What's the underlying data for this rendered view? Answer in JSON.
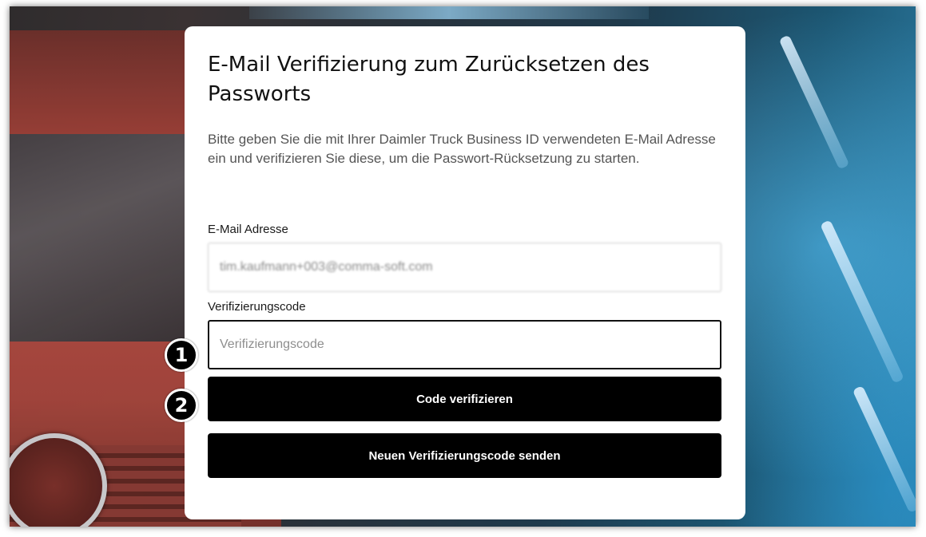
{
  "page": {
    "title": "E-Mail Verifizierung zum Zurücksetzen des Passworts",
    "description": "Bitte geben Sie die mit Ihrer Daimler Truck Business ID verwendeten E-Mail Adresse ein und verifizieren Sie diese, um die Passwort-Rücksetzung zu starten."
  },
  "form": {
    "email_label": "E-Mail Adresse",
    "email_value": "tim.kaufmann+003@comma-soft.com",
    "code_label": "Verifizierungscode",
    "code_placeholder": "Verifizierungscode",
    "code_value": ""
  },
  "buttons": {
    "verify_label": "Code verifizieren",
    "resend_label": "Neuen Verifizierungscode senden"
  },
  "annotations": {
    "step1": "1",
    "step2": "2"
  },
  "colors": {
    "button_bg": "#000000",
    "button_text": "#ffffff",
    "card_bg": "#ffffff",
    "focus_border": "#111111"
  }
}
